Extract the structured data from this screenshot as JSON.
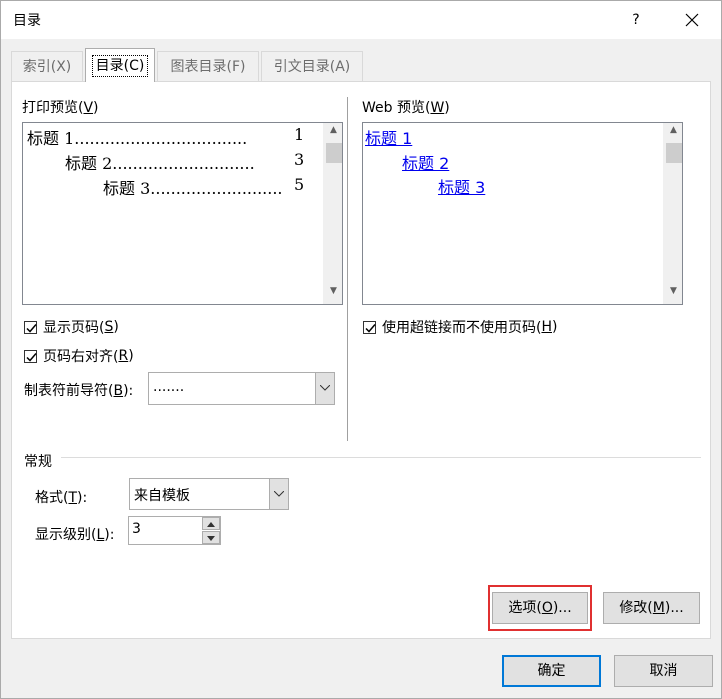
{
  "window": {
    "title": "目录",
    "help": "?",
    "close_icon": "close-icon"
  },
  "tabs": [
    {
      "label": "索引(X)",
      "active": false
    },
    {
      "label": "目录(C)",
      "active": true
    },
    {
      "label": "图表目录(F)",
      "active": false
    },
    {
      "label": "引文目录(A)",
      "active": false
    }
  ],
  "print_preview": {
    "label_text": "打印预览(",
    "label_key": "V",
    "label_end": ")",
    "lines": [
      {
        "text": "标题  1",
        "page": "1"
      },
      {
        "text": "标题  2",
        "page": "3"
      },
      {
        "text": "标题  3",
        "page": "5"
      }
    ]
  },
  "web_preview": {
    "label_text": "Web 预览(",
    "label_key": "W",
    "label_end": ")",
    "links": [
      "标题  1",
      "标题  2",
      "标题  3"
    ]
  },
  "options": {
    "show_page_numbers": {
      "text": "显示页码(",
      "key": "S",
      "end": ")",
      "checked": true
    },
    "right_align": {
      "text": "页码右对齐(",
      "key": "R",
      "end": ")",
      "checked": true
    },
    "tab_leader_label": {
      "text": "制表符前导符(",
      "key": "B",
      "end": "):"
    },
    "tab_leader_value": ".......",
    "use_hyperlinks": {
      "text": "使用超链接而不使用页码(",
      "key": "H",
      "end": ")",
      "checked": true
    }
  },
  "general": {
    "section_label": "常规",
    "format_label": {
      "text": "格式(",
      "key": "T",
      "end": "):"
    },
    "format_value": "来自模板",
    "levels_label": {
      "text": "显示级别(",
      "key": "L",
      "end": "):"
    },
    "levels_value": "3"
  },
  "buttons": {
    "options": {
      "text": "选项(",
      "key": "O",
      "end": ")..."
    },
    "modify": {
      "text": "修改(",
      "key": "M",
      "end": ")..."
    },
    "ok": "确定",
    "cancel": "取消"
  },
  "colors": {
    "highlight": "#e03030",
    "link": "#0000ee",
    "focus": "#0078d7"
  }
}
